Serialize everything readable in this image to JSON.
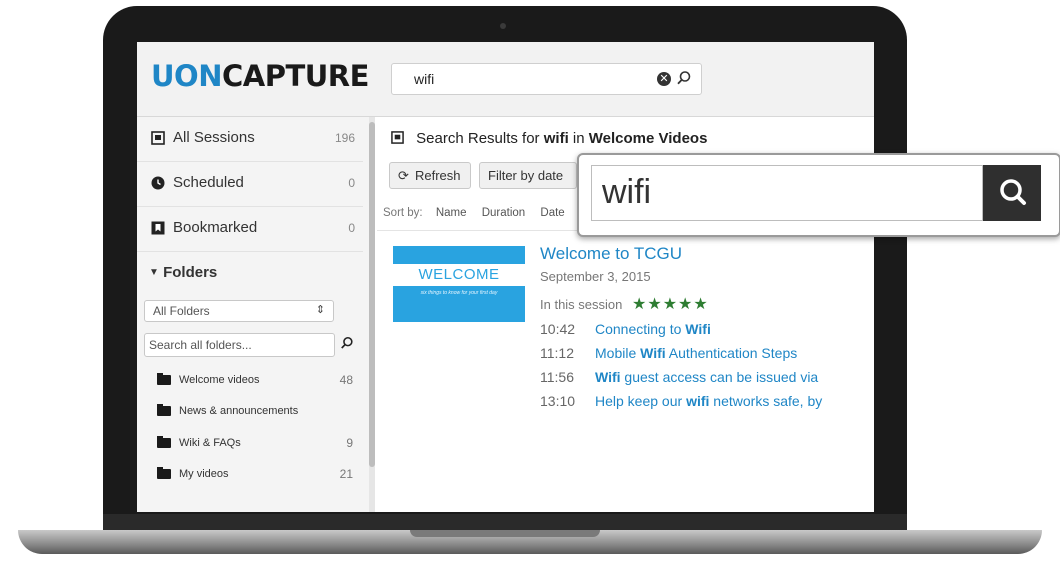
{
  "app": {
    "logo_part1": "UON",
    "logo_part2": "CAPTURE",
    "search_value": "wifi"
  },
  "sidebar": {
    "items": [
      {
        "label": "All Sessions",
        "count": "196",
        "icon": "sessions-icon"
      },
      {
        "label": "Scheduled",
        "count": "0",
        "icon": "clock-icon"
      },
      {
        "label": "Bookmarked",
        "count": "0",
        "icon": "bookmark-icon"
      }
    ],
    "folders_heading": "Folders",
    "folder_select": "All Folders",
    "folder_search_placeholder": "Search all folders...",
    "folders": [
      {
        "name": "Welcome videos",
        "count": "48"
      },
      {
        "name": "News & announcements",
        "count": ""
      },
      {
        "name": "Wiki & FAQs",
        "count": "9"
      },
      {
        "name": "My videos",
        "count": "21"
      }
    ]
  },
  "main": {
    "results_prefix": "Search Results for",
    "results_query": "wifi",
    "results_in": "in",
    "results_folder": "Welcome Videos",
    "refresh_label": "Refresh",
    "filter_label": "Filter by date",
    "sort_label": "Sort by:",
    "sort_options": [
      "Name",
      "Duration",
      "Date"
    ],
    "video": {
      "title": "Welcome to TCGU",
      "date": "September 3, 2015",
      "in_session": "In this session",
      "stars": "★★★★★",
      "thumb_text": "WELCOME",
      "thumb_tagline": "six things to know for your first day",
      "hits": [
        {
          "time": "10:42",
          "pre": "Connecting to ",
          "match": "Wifi",
          "post": ""
        },
        {
          "time": "11:12",
          "pre": "Mobile ",
          "match": "Wifi",
          "post": " Authentication Steps"
        },
        {
          "time": "11:56",
          "pre": "",
          "match": "Wifi",
          "post": " guest access can be issued via"
        },
        {
          "time": "13:10",
          "pre": "Help keep our ",
          "match": "wifi",
          "post": " networks safe, by"
        }
      ]
    }
  },
  "zoom_overlay": {
    "value": "wifi"
  },
  "colors": {
    "brand_blue": "#1f86c6",
    "star_green": "#2e7d32",
    "thumb_blue": "#29a3e0"
  }
}
